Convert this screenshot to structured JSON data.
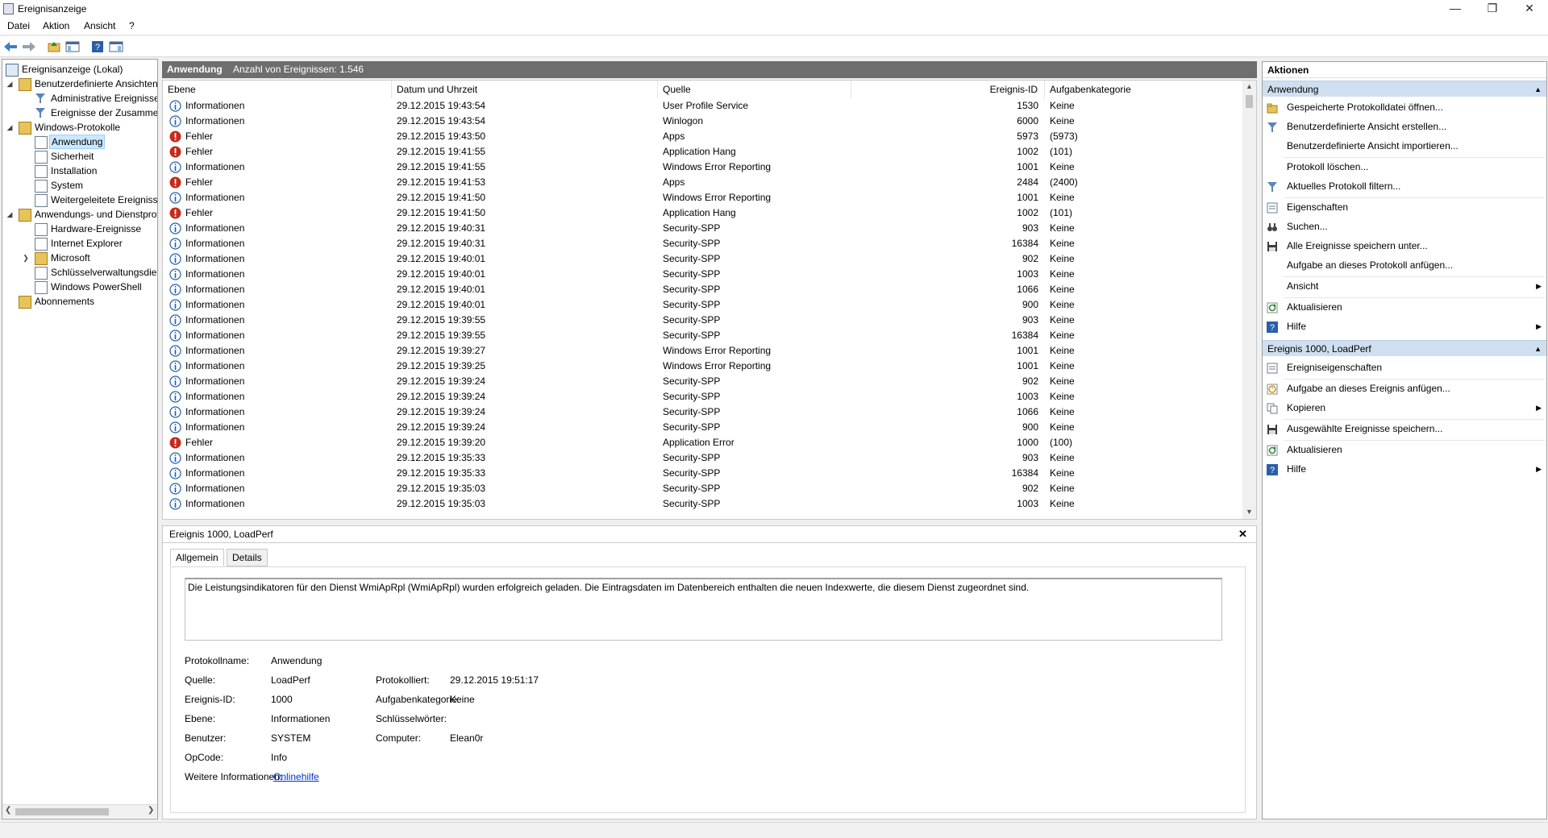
{
  "window": {
    "title": "Ereignisanzeige"
  },
  "menu": [
    {
      "label": "Datei"
    },
    {
      "label": "Aktion"
    },
    {
      "label": "Ansicht"
    },
    {
      "label": "?"
    }
  ],
  "tree": {
    "root": "Ereignisanzeige (Lokal)",
    "custom_views": "Benutzerdefinierte Ansichten",
    "admin_events": "Administrative Ereignisse",
    "summary_events": "Ereignisse der Zusammenfassung",
    "windows_logs": "Windows-Protokolle",
    "application": "Anwendung",
    "security": "Sicherheit",
    "setup": "Installation",
    "system": "System",
    "forwarded": "Weitergeleitete Ereignisse",
    "app_service_logs": "Anwendungs- und Dienstprotokolle",
    "hardware": "Hardware-Ereignisse",
    "ie": "Internet Explorer",
    "microsoft": "Microsoft",
    "key_mgmt": "Schlüsselverwaltungsdienst",
    "powershell": "Windows PowerShell",
    "subscriptions": "Abonnements"
  },
  "center": {
    "log_name": "Anwendung",
    "count_text": "Anzahl von Ereignissen: 1.546"
  },
  "columns": {
    "level": "Ebene",
    "datetime": "Datum und Uhrzeit",
    "source": "Quelle",
    "event_id": "Ereignis-ID",
    "category": "Aufgabenkategorie"
  },
  "events": [
    {
      "level": "Informationen",
      "type": "info",
      "datetime": "29.12.2015 19:43:54",
      "source": "User Profile Service",
      "id": "1530",
      "category": "Keine"
    },
    {
      "level": "Informationen",
      "type": "info",
      "datetime": "29.12.2015 19:43:54",
      "source": "Winlogon",
      "id": "6000",
      "category": "Keine"
    },
    {
      "level": "Fehler",
      "type": "error",
      "datetime": "29.12.2015 19:43:50",
      "source": "Apps",
      "id": "5973",
      "category": "(5973)"
    },
    {
      "level": "Fehler",
      "type": "error",
      "datetime": "29.12.2015 19:41:55",
      "source": "Application Hang",
      "id": "1002",
      "category": "(101)"
    },
    {
      "level": "Informationen",
      "type": "info",
      "datetime": "29.12.2015 19:41:55",
      "source": "Windows Error Reporting",
      "id": "1001",
      "category": "Keine"
    },
    {
      "level": "Fehler",
      "type": "error",
      "datetime": "29.12.2015 19:41:53",
      "source": "Apps",
      "id": "2484",
      "category": "(2400)"
    },
    {
      "level": "Informationen",
      "type": "info",
      "datetime": "29.12.2015 19:41:50",
      "source": "Windows Error Reporting",
      "id": "1001",
      "category": "Keine"
    },
    {
      "level": "Fehler",
      "type": "error",
      "datetime": "29.12.2015 19:41:50",
      "source": "Application Hang",
      "id": "1002",
      "category": "(101)"
    },
    {
      "level": "Informationen",
      "type": "info",
      "datetime": "29.12.2015 19:40:31",
      "source": "Security-SPP",
      "id": "903",
      "category": "Keine"
    },
    {
      "level": "Informationen",
      "type": "info",
      "datetime": "29.12.2015 19:40:31",
      "source": "Security-SPP",
      "id": "16384",
      "category": "Keine"
    },
    {
      "level": "Informationen",
      "type": "info",
      "datetime": "29.12.2015 19:40:01",
      "source": "Security-SPP",
      "id": "902",
      "category": "Keine"
    },
    {
      "level": "Informationen",
      "type": "info",
      "datetime": "29.12.2015 19:40:01",
      "source": "Security-SPP",
      "id": "1003",
      "category": "Keine"
    },
    {
      "level": "Informationen",
      "type": "info",
      "datetime": "29.12.2015 19:40:01",
      "source": "Security-SPP",
      "id": "1066",
      "category": "Keine"
    },
    {
      "level": "Informationen",
      "type": "info",
      "datetime": "29.12.2015 19:40:01",
      "source": "Security-SPP",
      "id": "900",
      "category": "Keine"
    },
    {
      "level": "Informationen",
      "type": "info",
      "datetime": "29.12.2015 19:39:55",
      "source": "Security-SPP",
      "id": "903",
      "category": "Keine"
    },
    {
      "level": "Informationen",
      "type": "info",
      "datetime": "29.12.2015 19:39:55",
      "source": "Security-SPP",
      "id": "16384",
      "category": "Keine"
    },
    {
      "level": "Informationen",
      "type": "info",
      "datetime": "29.12.2015 19:39:27",
      "source": "Windows Error Reporting",
      "id": "1001",
      "category": "Keine"
    },
    {
      "level": "Informationen",
      "type": "info",
      "datetime": "29.12.2015 19:39:25",
      "source": "Windows Error Reporting",
      "id": "1001",
      "category": "Keine"
    },
    {
      "level": "Informationen",
      "type": "info",
      "datetime": "29.12.2015 19:39:24",
      "source": "Security-SPP",
      "id": "902",
      "category": "Keine"
    },
    {
      "level": "Informationen",
      "type": "info",
      "datetime": "29.12.2015 19:39:24",
      "source": "Security-SPP",
      "id": "1003",
      "category": "Keine"
    },
    {
      "level": "Informationen",
      "type": "info",
      "datetime": "29.12.2015 19:39:24",
      "source": "Security-SPP",
      "id": "1066",
      "category": "Keine"
    },
    {
      "level": "Informationen",
      "type": "info",
      "datetime": "29.12.2015 19:39:24",
      "source": "Security-SPP",
      "id": "900",
      "category": "Keine"
    },
    {
      "level": "Fehler",
      "type": "error",
      "datetime": "29.12.2015 19:39:20",
      "source": "Application Error",
      "id": "1000",
      "category": "(100)"
    },
    {
      "level": "Informationen",
      "type": "info",
      "datetime": "29.12.2015 19:35:33",
      "source": "Security-SPP",
      "id": "903",
      "category": "Keine"
    },
    {
      "level": "Informationen",
      "type": "info",
      "datetime": "29.12.2015 19:35:33",
      "source": "Security-SPP",
      "id": "16384",
      "category": "Keine"
    },
    {
      "level": "Informationen",
      "type": "info",
      "datetime": "29.12.2015 19:35:03",
      "source": "Security-SPP",
      "id": "902",
      "category": "Keine"
    },
    {
      "level": "Informationen",
      "type": "info",
      "datetime": "29.12.2015 19:35:03",
      "source": "Security-SPP",
      "id": "1003",
      "category": "Keine"
    }
  ],
  "detail": {
    "title": "Ereignis 1000, LoadPerf",
    "tab_general": "Allgemein",
    "tab_details": "Details",
    "description": "Die Leistungsindikatoren für den Dienst WmiApRpl (WmiApRpl) wurden erfolgreich geladen. Die Eintragsdaten im Datenbereich enthalten die neuen Indexwerte, die diesem Dienst zugeordnet sind.",
    "labels": {
      "log_name": "Protokollname:",
      "source": "Quelle:",
      "event_id": "Ereignis-ID:",
      "level": "Ebene:",
      "user": "Benutzer:",
      "opcode": "OpCode:",
      "more_info": "Weitere Informationen:",
      "logged": "Protokolliert:",
      "category": "Aufgabenkategorie:",
      "keywords": "Schlüsselwörter:",
      "computer": "Computer:"
    },
    "values": {
      "log_name": "Anwendung",
      "source": "LoadPerf",
      "event_id": "1000",
      "level": "Informationen",
      "user": "SYSTEM",
      "opcode": "Info",
      "more_info_link": "Onlinehilfe",
      "logged": "29.12.2015 19:51:17",
      "category": "Keine",
      "keywords": "",
      "computer": "Elean0r"
    }
  },
  "actions": {
    "header": "Aktionen",
    "section1": "Anwendung",
    "items1": [
      {
        "label": "Gespeicherte Protokolldatei öffnen...",
        "icon": "open-folder-icon",
        "submenu": false
      },
      {
        "label": "Benutzerdefinierte Ansicht erstellen...",
        "icon": "filter-icon",
        "submenu": false
      },
      {
        "label": "Benutzerdefinierte Ansicht importieren...",
        "icon": "",
        "submenu": false
      },
      {
        "label": "Protokoll löschen...",
        "icon": "",
        "submenu": false
      },
      {
        "label": "Aktuelles Protokoll filtern...",
        "icon": "filter-icon",
        "submenu": false
      },
      {
        "label": "Eigenschaften",
        "icon": "properties-icon",
        "submenu": false
      },
      {
        "label": "Suchen...",
        "icon": "binoculars-icon",
        "submenu": false
      },
      {
        "label": "Alle Ereignisse speichern unter...",
        "icon": "save-icon",
        "submenu": false
      },
      {
        "label": "Aufgabe an dieses Protokoll anfügen...",
        "icon": "",
        "submenu": false
      },
      {
        "label": "Ansicht",
        "icon": "",
        "submenu": true
      },
      {
        "label": "Aktualisieren",
        "icon": "refresh-icon",
        "submenu": false
      },
      {
        "label": "Hilfe",
        "icon": "help-icon",
        "submenu": true
      }
    ],
    "section2": "Ereignis 1000, LoadPerf",
    "items2": [
      {
        "label": "Ereigniseigenschaften",
        "icon": "properties-icon",
        "submenu": false
      },
      {
        "label": "Aufgabe an dieses Ereignis anfügen...",
        "icon": "task-icon",
        "submenu": false
      },
      {
        "label": "Kopieren",
        "icon": "copy-icon",
        "submenu": true
      },
      {
        "label": "Ausgewählte Ereignisse speichern...",
        "icon": "save-icon",
        "submenu": false
      },
      {
        "label": "Aktualisieren",
        "icon": "refresh-icon",
        "submenu": false
      },
      {
        "label": "Hilfe",
        "icon": "help-icon",
        "submenu": true
      }
    ]
  },
  "colors": {
    "header_bar": "#6e6e6e",
    "section_header": "#cfdff0",
    "selection": "#cce8ff",
    "error_red": "#c42b1c",
    "info_blue": "#1f5fa8",
    "link": "#0033cc"
  }
}
